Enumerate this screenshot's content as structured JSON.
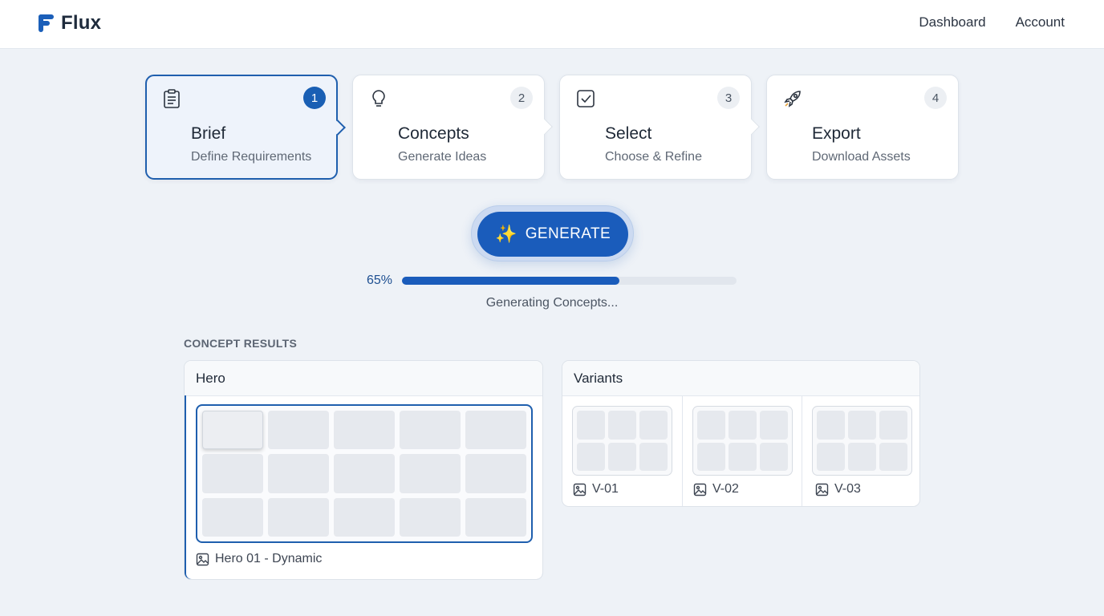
{
  "app": {
    "name": "Flux"
  },
  "nav": {
    "items": [
      "Dashboard",
      "Account"
    ]
  },
  "steps": [
    {
      "num": "1",
      "title": "Brief",
      "subtitle": "Define Requirements",
      "icon": "clipboard-icon",
      "active": true
    },
    {
      "num": "2",
      "title": "Concepts",
      "subtitle": "Generate Ideas",
      "icon": "lightbulb-icon",
      "active": false
    },
    {
      "num": "3",
      "title": "Select",
      "subtitle": "Choose & Refine",
      "icon": "checkbox-icon",
      "active": false
    },
    {
      "num": "4",
      "title": "Export",
      "subtitle": "Download Assets",
      "icon": "rocket-icon",
      "active": false
    }
  ],
  "generate": {
    "label": "GENERATE",
    "icon": "sparkle-icon"
  },
  "progress": {
    "percent_label": "65%",
    "value": 0.65,
    "status": "Generating Concepts..."
  },
  "results": {
    "label": "CONCEPT RESULTS",
    "hero": {
      "title": "Hero",
      "caption": "Hero 01 - Dynamic"
    },
    "variants": {
      "title": "Variants",
      "items": [
        "V-01",
        "V-02",
        "V-03"
      ]
    }
  },
  "colors": {
    "accent": "#1a5cbb",
    "active_border": "#1f5fae",
    "background": "#eef2f7"
  }
}
